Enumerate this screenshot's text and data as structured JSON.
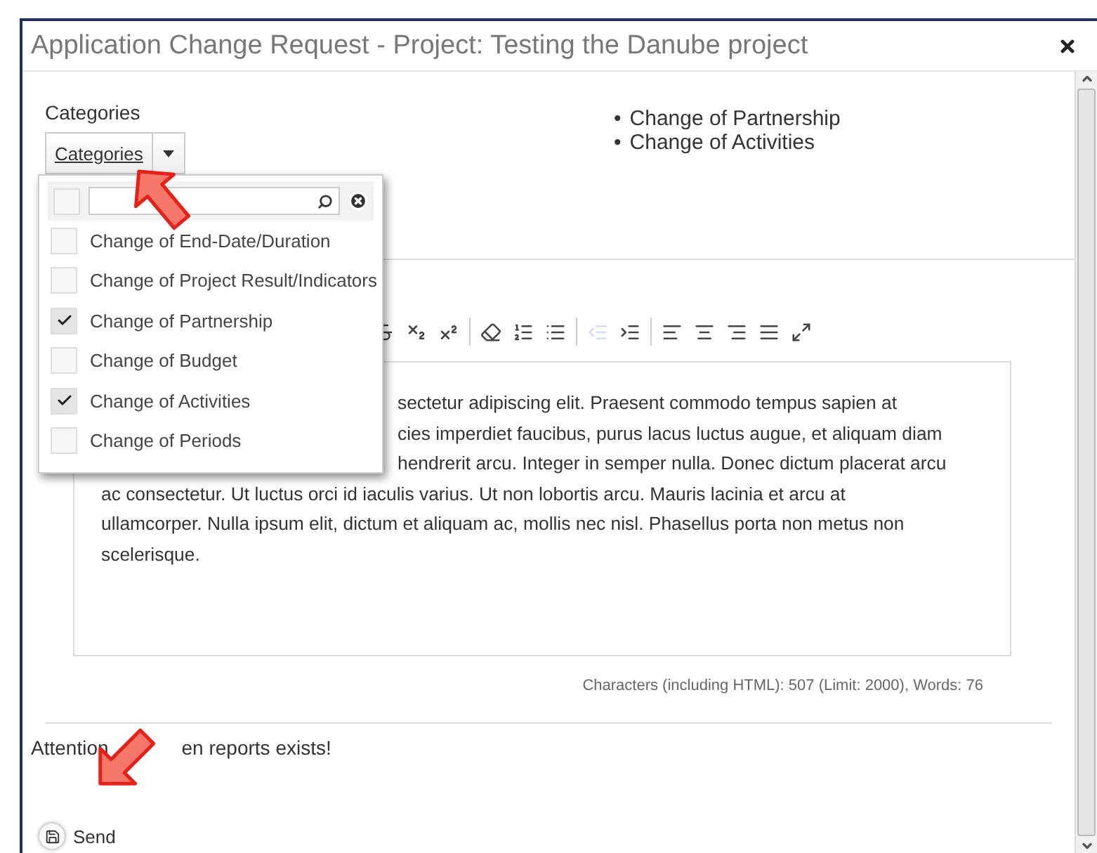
{
  "dialog": {
    "title": "Application Change Request - Project: Testing the Danube project"
  },
  "categories": {
    "label": "Categories",
    "button": "Categories",
    "chosen": [
      {
        "bullet": "•",
        "text": "Change of Partnership"
      },
      {
        "bullet": "•",
        "text": "Change of Activities"
      }
    ]
  },
  "dropdown": {
    "select_all_checked": false,
    "items": [
      {
        "label": "Change of End-Date/Duration",
        "checked": false
      },
      {
        "label": "Change of Project Result/Indicators",
        "checked": false
      },
      {
        "label": "Change of Partnership",
        "checked": true
      },
      {
        "label": "Change of Budget",
        "checked": false
      },
      {
        "label": "Change of Activities",
        "checked": true
      },
      {
        "label": "Change of Periods",
        "checked": false
      }
    ]
  },
  "editor": {
    "toolbar": [
      {
        "kind": "strikethrough",
        "disabled": false
      },
      {
        "kind": "subscript",
        "disabled": false
      },
      {
        "kind": "superscript",
        "disabled": false
      },
      {
        "kind": "separator"
      },
      {
        "kind": "remove-format",
        "disabled": false
      },
      {
        "kind": "numbered-list",
        "disabled": false
      },
      {
        "kind": "bullet-list",
        "disabled": false
      },
      {
        "kind": "separator"
      },
      {
        "kind": "outdent",
        "disabled": true
      },
      {
        "kind": "indent",
        "disabled": false
      },
      {
        "kind": "separator"
      },
      {
        "kind": "align-left",
        "disabled": false
      },
      {
        "kind": "align-center",
        "disabled": false
      },
      {
        "kind": "align-right",
        "disabled": false
      },
      {
        "kind": "justify",
        "disabled": false
      },
      {
        "kind": "maximize",
        "disabled": false
      }
    ],
    "lines_beside_menu": [
      "sectetur adipiscing elit. Praesent commodo tempus sapien at",
      "cies imperdiet faucibus, purus lacus luctus augue, et aliquam diam",
      "hendrerit arcu. Integer in semper nulla. Donec dictum placerat arcu"
    ],
    "lines": [
      "ac consectetur. Ut luctus orci id iaculis varius. Ut non lobortis arcu. Mauris lacinia et arcu at",
      "ullamcorper. Nulla ipsum elit, dictum et aliquam ac, mollis nec nisl. Phasellus porta non metus non",
      "scelerisque."
    ],
    "counter": "Characters (including HTML): 507 (Limit: 2000), Words: 76"
  },
  "notice": [
    "Attention",
    "en reports exists!"
  ],
  "send_button": "Send"
}
